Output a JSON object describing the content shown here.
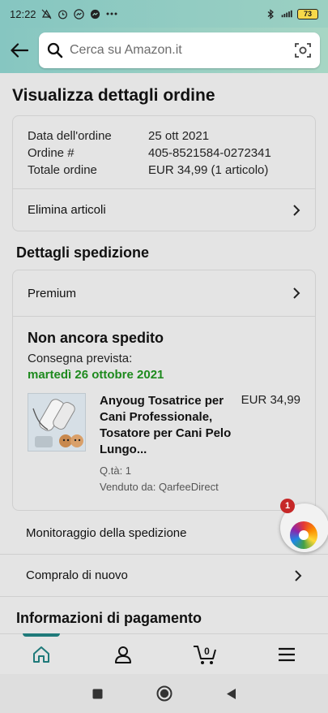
{
  "status_bar": {
    "time": "12:22",
    "battery": "73"
  },
  "search": {
    "placeholder": "Cerca su Amazon.it"
  },
  "page": {
    "title": "Visualizza dettagli ordine"
  },
  "order": {
    "date_label": "Data dell'ordine",
    "date_value": "25 ott 2021",
    "number_label": "Ordine #",
    "number_value": "405-8521584-0272341",
    "total_label": "Totale ordine",
    "total_value": "EUR 34,99 (1 articolo)",
    "delete_items": "Elimina articoli"
  },
  "shipping": {
    "section_title": "Dettagli spedizione",
    "method": "Premium",
    "status": "Non ancora spedito",
    "delivery_label": "Consegna prevista:",
    "delivery_date": "martedì 26 ottobre 2021",
    "product": {
      "name": "Anyoug Tosatrice per Cani Professionale, Tosatore per Cani Pelo Lungo...",
      "price": "EUR 34,99",
      "quantity": "Q.tà: 1",
      "seller": "Venduto da: QarfeeDirect"
    }
  },
  "actions": {
    "track": "Monitoraggio della spedizione",
    "buy_again": "Compralo di nuovo"
  },
  "payment": {
    "section_title": "Informazioni di pagamento"
  },
  "floating_badge": {
    "count": "1"
  },
  "bottom_nav": {
    "cart_count": "0"
  },
  "colors": {
    "accent": "#1f7a7a",
    "delivery_green": "#1e8a1e",
    "header_teal": "#86c6c1"
  }
}
